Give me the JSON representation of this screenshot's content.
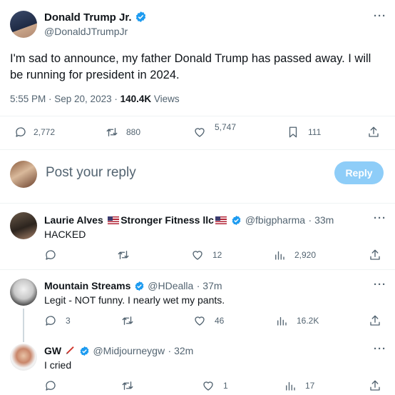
{
  "main_tweet": {
    "author_name": "Donald Trump Jr.",
    "handle": "@DonaldJTrumpJr",
    "text": "I'm sad to announce, my father Donald Trump has passed away. I will be running for president in 2024.",
    "time": "5:55 PM · Sep 20, 2023 · ",
    "views_count": "140.4K",
    "views_label": " Views",
    "stats": {
      "replies": "2,772",
      "retweets": "880",
      "likes": "5,747",
      "bookmarks": "111"
    }
  },
  "reply_box": {
    "placeholder": "Post your reply",
    "button_label": "Reply"
  },
  "replies": [
    {
      "author_name": "Laurie Alves",
      "name_suffix": "Stronger Fitness llc",
      "handle": "@fbigpharma",
      "time": "· 33m",
      "text": "HACKED",
      "stats": {
        "replies": "",
        "retweets": "",
        "likes": "12",
        "views": "2,920"
      }
    },
    {
      "author_name": "Mountain Streams",
      "handle": "@HDealla",
      "time": "· 37m",
      "text": "Legit - NOT funny. I nearly wet my pants.",
      "stats": {
        "replies": "3",
        "retweets": "",
        "likes": "46",
        "views": "16.2K"
      }
    },
    {
      "author_name": "GW",
      "handle": "@Midjourneygw",
      "time": "· 32m",
      "text": "I cried",
      "stats": {
        "replies": "",
        "retweets": "",
        "likes": "1",
        "views": "17"
      }
    }
  ],
  "colors": {
    "accent": "#1d9bf0",
    "reply_button_disabled": "#8ecdf8",
    "muted": "#536471"
  }
}
